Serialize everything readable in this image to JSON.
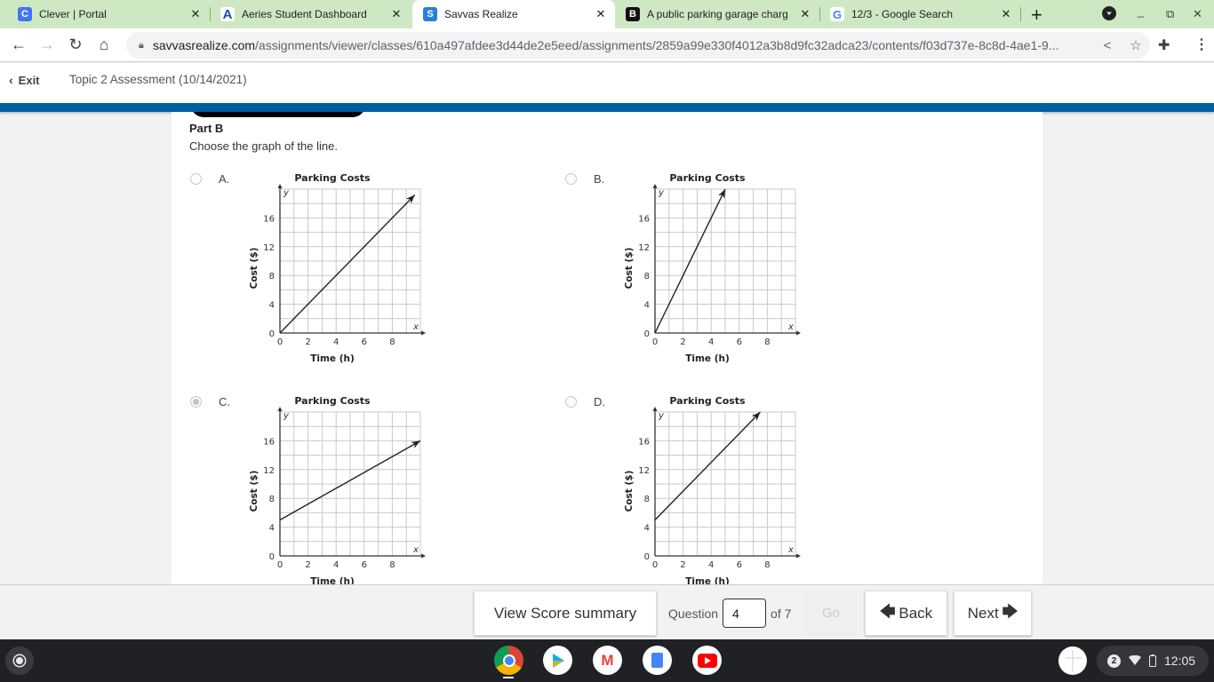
{
  "browser": {
    "tabs": [
      {
        "title": "Clever | Portal",
        "icon": "clever-icon",
        "icon_glyph": "C",
        "icon_color": "#4274f6",
        "active": false
      },
      {
        "title": "Aeries Student Dashboard",
        "icon": "aeries-icon",
        "icon_glyph": "A",
        "icon_color": "#1a4fa0",
        "active": false
      },
      {
        "title": "Savvas Realize",
        "icon": "savvas-icon",
        "icon_glyph": "S",
        "icon_color": "#2a7de1",
        "active": true
      },
      {
        "title": "A public parking garage charg",
        "icon": "brainly-icon",
        "icon_glyph": "B",
        "icon_color": "#111111",
        "active": false
      },
      {
        "title": "12/3 - Google Search",
        "icon": "google-icon",
        "icon_glyph": "G",
        "icon_color": "#4285f4",
        "active": false
      }
    ],
    "close_glyph": "✕",
    "new_tab_glyph": "+",
    "url_host": "savvasrealize.com",
    "url_path": "/assignments/viewer/classes/610a497afdee3d44de2e5eed/assignments/2859a99e330f4012a3b8d9fc32adca23/contents/f03d737e-8c8d-4ae1-9..."
  },
  "app": {
    "exit_label": "Exit",
    "assessment_title": "Topic 2 Assessment (10/14/2021)"
  },
  "question": {
    "part_label": "Part B",
    "prompt": "Choose the graph of the line.",
    "options": [
      {
        "letter": "A.",
        "selected": false
      },
      {
        "letter": "B.",
        "selected": false
      },
      {
        "letter": "C.",
        "selected": true
      },
      {
        "letter": "D.",
        "selected": false
      }
    ]
  },
  "chart_data": [
    {
      "type": "line",
      "title": "Parking Costs",
      "xlabel": "Time (h)",
      "ylabel": "Cost ($)",
      "x_axis_var": "x",
      "y_axis_var": "y",
      "xlim": [
        0,
        10
      ],
      "ylim": [
        0,
        20
      ],
      "xticks": [
        "0",
        "2",
        "4",
        "6",
        "8"
      ],
      "yticks": [
        "0",
        "4",
        "8",
        "12",
        "16"
      ],
      "grid": true,
      "series": [
        {
          "name": "A",
          "x": [
            0,
            9.6
          ],
          "y": [
            0,
            19.2
          ]
        }
      ]
    },
    {
      "type": "line",
      "title": "Parking Costs",
      "xlabel": "Time (h)",
      "ylabel": "Cost ($)",
      "x_axis_var": "x",
      "y_axis_var": "y",
      "xlim": [
        0,
        10
      ],
      "ylim": [
        0,
        20
      ],
      "xticks": [
        "0",
        "2",
        "4",
        "6",
        "8"
      ],
      "yticks": [
        "0",
        "4",
        "8",
        "12",
        "16"
      ],
      "grid": true,
      "series": [
        {
          "name": "B",
          "x": [
            0,
            5
          ],
          "y": [
            0,
            20
          ]
        }
      ]
    },
    {
      "type": "line",
      "title": "Parking Costs",
      "xlabel": "Time (h)",
      "ylabel": "Cost ($)",
      "x_axis_var": "x",
      "y_axis_var": "y",
      "xlim": [
        0,
        10
      ],
      "ylim": [
        0,
        20
      ],
      "xticks": [
        "0",
        "2",
        "4",
        "6",
        "8"
      ],
      "yticks": [
        "0",
        "4",
        "8",
        "12",
        "16"
      ],
      "grid": true,
      "series": [
        {
          "name": "C",
          "x": [
            0,
            10
          ],
          "y": [
            5,
            16
          ]
        }
      ]
    },
    {
      "type": "line",
      "title": "Parking Costs",
      "xlabel": "Time (h)",
      "ylabel": "Cost ($)",
      "x_axis_var": "x",
      "y_axis_var": "y",
      "xlim": [
        0,
        10
      ],
      "ylim": [
        0,
        20
      ],
      "xticks": [
        "0",
        "2",
        "4",
        "6",
        "8"
      ],
      "yticks": [
        "0",
        "4",
        "8",
        "12",
        "16"
      ],
      "grid": true,
      "series": [
        {
          "name": "D",
          "x": [
            0,
            7.5
          ],
          "y": [
            5,
            20
          ]
        }
      ]
    }
  ],
  "footer": {
    "score_summary_label": "View Score summary",
    "question_label": "Question",
    "question_value": "4",
    "of_label": "of 7",
    "go_label": "Go",
    "back_label": "Back",
    "next_label": "Next"
  },
  "shelf": {
    "apps": [
      {
        "name": "chrome-icon",
        "color": "#db4437"
      },
      {
        "name": "play-store-icon",
        "color": "#ffffff"
      },
      {
        "name": "gmail-icon",
        "color": "#ffffff"
      },
      {
        "name": "google-docs-icon",
        "color": "#ffffff"
      },
      {
        "name": "youtube-icon",
        "color": "#ffffff"
      }
    ],
    "notification_count": "2",
    "time": "12:05"
  }
}
